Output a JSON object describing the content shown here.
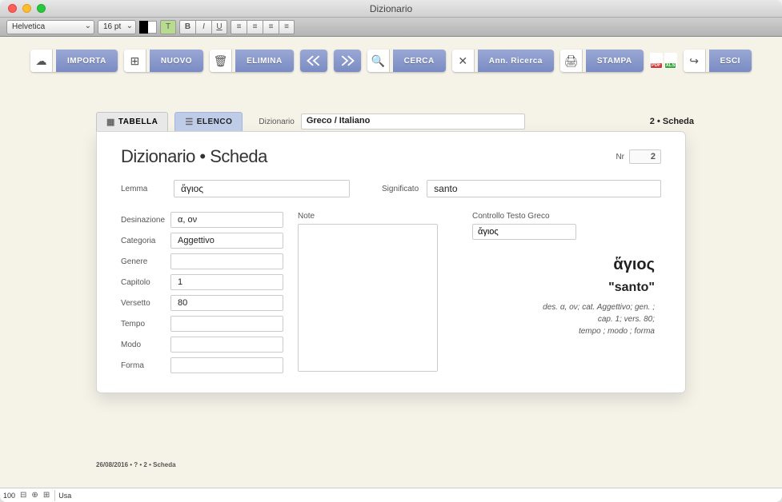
{
  "window": {
    "title": "Dizionario"
  },
  "format": {
    "font": "Helvetica",
    "size": "16 pt"
  },
  "toolbar": {
    "importa": "IMPORTA",
    "nuovo": "NUOVO",
    "elimina": "ELIMINA",
    "cerca": "CERCA",
    "annricerca": "Ann. Ricerca",
    "stampa": "STAMPA",
    "esci": "ESCI"
  },
  "tabs": {
    "tabella": "TABELLA",
    "elenco": "ELENCO",
    "dict_label": "Dizionario",
    "dict_value": "Greco / Italiano",
    "counter": "2 • Scheda"
  },
  "card": {
    "title": "Dizionario • Scheda",
    "nr_label": "Nr",
    "nr_value": "2",
    "lemma_label": "Lemma",
    "lemma_value": "ἅγιος",
    "sig_label": "Significato",
    "sig_value": "santo",
    "fields": {
      "desinazione": {
        "label": "Desinazione",
        "value": "α, ον"
      },
      "categoria": {
        "label": "Categoria",
        "value": "Aggettivo"
      },
      "genere": {
        "label": "Genere",
        "value": ""
      },
      "capitolo": {
        "label": "Capitolo",
        "value": "1"
      },
      "versetto": {
        "label": "Versetto",
        "value": "80"
      },
      "tempo": {
        "label": "Tempo",
        "value": ""
      },
      "modo": {
        "label": "Modo",
        "value": ""
      },
      "forma": {
        "label": "Forma",
        "value": ""
      }
    },
    "note_label": "Note",
    "ctrl_label": "Controllo Testo Greco",
    "ctrl_value": "ἅγιος",
    "preview": {
      "big": "ἅγιος",
      "trans": "\"santo\"",
      "meta1": "des. α, ον; cat. Aggettivo;  gen. ;",
      "meta2": "cap. 1; vers. 80;",
      "meta3": "tempo ; modo ; forma"
    }
  },
  "footer_meta": "26/08/2016 • ? • 2 • Scheda",
  "status": {
    "zoom": "100",
    "user": "Usa"
  }
}
